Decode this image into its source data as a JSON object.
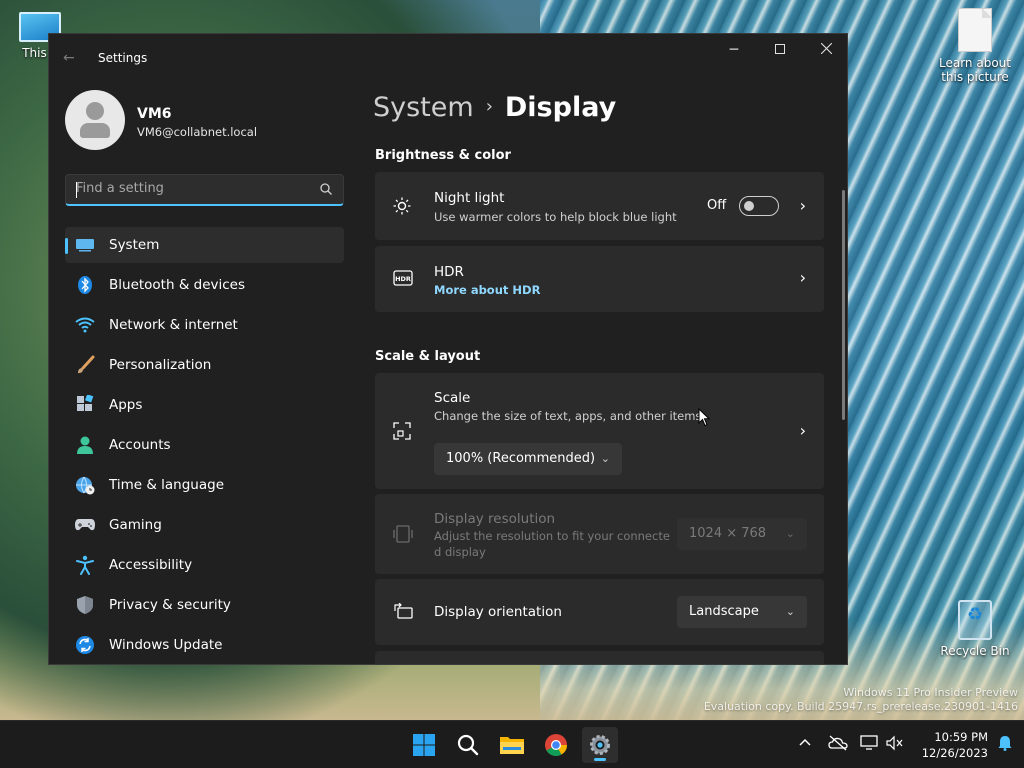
{
  "desktop": {
    "icons": [
      {
        "label": "This P"
      },
      {
        "label": "Learn about this picture"
      },
      {
        "label": "Recycle Bin"
      }
    ],
    "watermark": {
      "line1": "Windows 11 Pro Insider Preview",
      "line2": "Evaluation copy. Build 25947.rs_prerelease.230901-1416"
    }
  },
  "window": {
    "title": "Settings",
    "user": {
      "name": "VM6",
      "email": "VM6@collabnet.local"
    },
    "search": {
      "placeholder": "Find a setting"
    },
    "nav": [
      {
        "label": "System",
        "icon": "system-icon",
        "active": true
      },
      {
        "label": "Bluetooth & devices",
        "icon": "bluetooth-icon"
      },
      {
        "label": "Network & internet",
        "icon": "network-icon"
      },
      {
        "label": "Personalization",
        "icon": "brush-icon"
      },
      {
        "label": "Apps",
        "icon": "apps-icon"
      },
      {
        "label": "Accounts",
        "icon": "accounts-icon"
      },
      {
        "label": "Time & language",
        "icon": "globe-clock-icon"
      },
      {
        "label": "Gaming",
        "icon": "gamepad-icon"
      },
      {
        "label": "Accessibility",
        "icon": "accessibility-icon"
      },
      {
        "label": "Privacy & security",
        "icon": "shield-icon"
      },
      {
        "label": "Windows Update",
        "icon": "update-icon"
      }
    ],
    "breadcrumb": {
      "parent": "System",
      "current": "Display"
    },
    "sections": {
      "brightness": "Brightness & color",
      "scale_layout": "Scale & layout"
    },
    "night_light": {
      "title": "Night light",
      "subtitle": "Use warmer colors to help block blue light",
      "state": "Off"
    },
    "hdr": {
      "title": "HDR",
      "link": "More about HDR"
    },
    "scale": {
      "title": "Scale",
      "subtitle": "Change the size of text, apps, and other items",
      "value": "100% (Recommended)"
    },
    "resolution": {
      "title": "Display resolution",
      "subtitle_line1": "Adjust the resolution to fit your connecte",
      "subtitle_line2": "d display",
      "value": "1024 × 768"
    },
    "orientation": {
      "title": "Display orientation",
      "value": "Landscape"
    }
  },
  "taskbar": {
    "apps": [
      "start-icon",
      "search-icon",
      "file-explorer-icon",
      "chrome-icon",
      "settings-icon"
    ],
    "time": "10:59 PM",
    "date": "12/26/2023"
  },
  "colors": {
    "accent": "#4cc2ff",
    "window_bg": "#202020",
    "card_bg": "#2b2b2b"
  }
}
